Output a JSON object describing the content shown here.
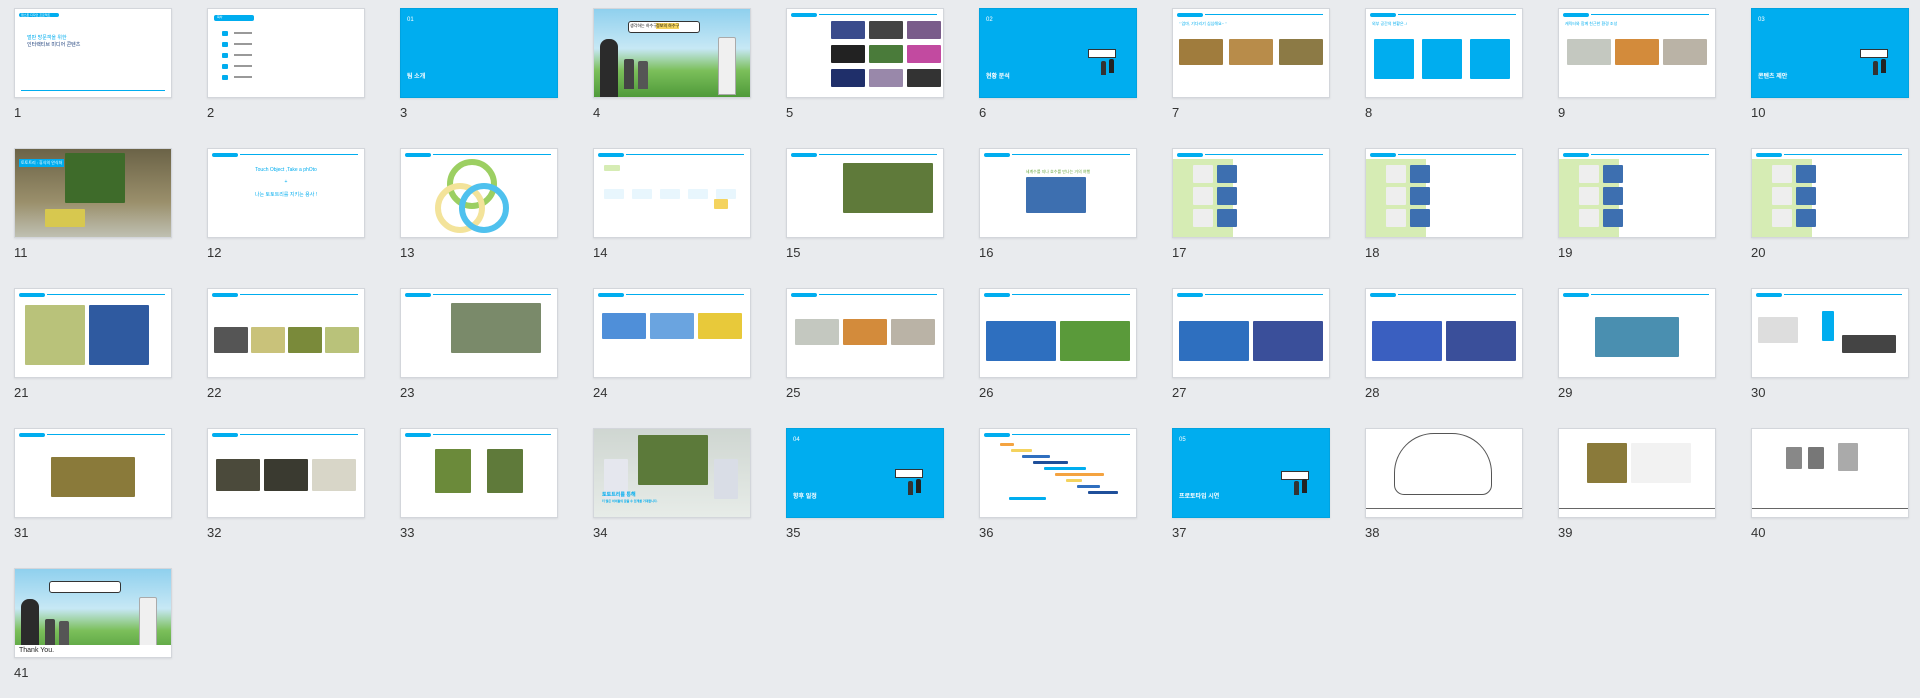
{
  "panel": {
    "slides": [
      {
        "num": "1",
        "type": "title",
        "lines": [
          "캡스톤 디자인 프로젝트",
          "벌판 방문객을 위한",
          "인터랙티브 미디어 콘텐츠"
        ]
      },
      {
        "num": "2",
        "type": "toc",
        "lines": [
          "목차"
        ]
      },
      {
        "num": "3",
        "type": "section",
        "section_no": "01",
        "text": "팀 소개"
      },
      {
        "num": "4",
        "type": "photo",
        "lines": [
          "생각하는 하수구",
          "정보의 하수구"
        ]
      },
      {
        "num": "5",
        "type": "grid"
      },
      {
        "num": "6",
        "type": "section",
        "section_no": "02",
        "text": "현황 분석"
      },
      {
        "num": "7",
        "type": "quote",
        "lines": [
          "\" 엄마, 기다리기 심심해요~ \""
        ]
      },
      {
        "num": "8",
        "type": "three",
        "lines": [
          "외부 공간의 현황은..!"
        ]
      },
      {
        "num": "9",
        "type": "three",
        "lines": [
          "캐릭터와 함께 친근한 환경 조성"
        ]
      },
      {
        "num": "10",
        "type": "section",
        "section_no": "03",
        "text": "콘텐츠 제안"
      },
      {
        "num": "11",
        "type": "photo",
        "lines": [
          "토토트리 : 휴식의 안식처"
        ]
      },
      {
        "num": "12",
        "type": "text",
        "lines": [
          "Touch Object ,Take a phOto",
          "+",
          "나는 토토트리를 지키는 용사 !"
        ]
      },
      {
        "num": "13",
        "type": "venn"
      },
      {
        "num": "14",
        "type": "flow"
      },
      {
        "num": "15",
        "type": "render"
      },
      {
        "num": "16",
        "type": "render",
        "lines": [
          "세계수를 지나 호수를 만나는 거의 여행"
        ]
      },
      {
        "num": "17",
        "type": "green"
      },
      {
        "num": "18",
        "type": "green"
      },
      {
        "num": "19",
        "type": "green"
      },
      {
        "num": "20",
        "type": "green"
      },
      {
        "num": "21",
        "type": "two"
      },
      {
        "num": "22",
        "type": "four"
      },
      {
        "num": "23",
        "type": "render"
      },
      {
        "num": "24",
        "type": "three"
      },
      {
        "num": "25",
        "type": "three"
      },
      {
        "num": "26",
        "type": "two"
      },
      {
        "num": "27",
        "type": "two"
      },
      {
        "num": "28",
        "type": "two"
      },
      {
        "num": "29",
        "type": "one"
      },
      {
        "num": "30",
        "type": "diagram"
      },
      {
        "num": "31",
        "type": "one"
      },
      {
        "num": "32",
        "type": "three"
      },
      {
        "num": "33",
        "type": "two"
      },
      {
        "num": "34",
        "type": "photo",
        "lines": [
          "토토트리를 통해",
          "더 많은 아이들의 꿈을 수 있게를 기대합니다."
        ]
      },
      {
        "num": "35",
        "type": "section",
        "section_no": "04",
        "text": "향후 일정"
      },
      {
        "num": "36",
        "type": "gantt"
      },
      {
        "num": "37",
        "type": "section",
        "section_no": "05",
        "text": "프로토타입 시연"
      },
      {
        "num": "38",
        "type": "sketch"
      },
      {
        "num": "39",
        "type": "sketch"
      },
      {
        "num": "40",
        "type": "sketch"
      },
      {
        "num": "41",
        "type": "photo",
        "lines": [
          "Thank You."
        ]
      }
    ]
  },
  "colors": {
    "accent": "#00adef",
    "background": "#e9ebee",
    "green": "#d6ecb4"
  }
}
